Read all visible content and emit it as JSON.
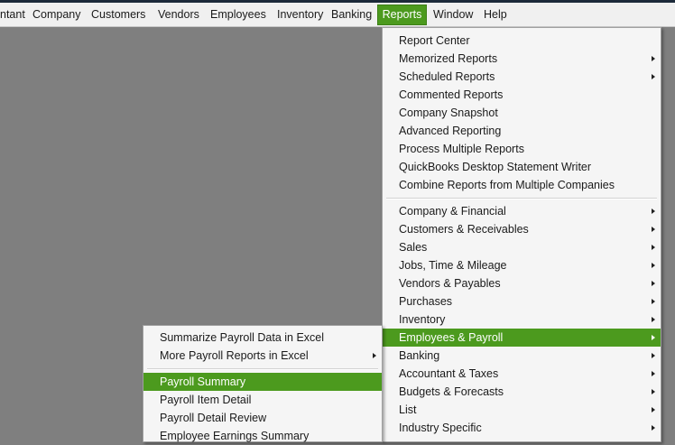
{
  "menubar": {
    "items": [
      {
        "label": "ntant"
      },
      {
        "label": "Company"
      },
      {
        "label": "Customers"
      },
      {
        "label": "Vendors"
      },
      {
        "label": "Employees"
      },
      {
        "label": "Inventory"
      },
      {
        "label": "Banking"
      },
      {
        "label": "Reports"
      },
      {
        "label": "Window"
      },
      {
        "label": "Help"
      }
    ]
  },
  "reports_menu": {
    "items": [
      {
        "label": "Report Center"
      },
      {
        "label": "Memorized Reports"
      },
      {
        "label": "Scheduled Reports"
      },
      {
        "label": "Commented Reports"
      },
      {
        "label": "Company Snapshot"
      },
      {
        "label": "Advanced Reporting"
      },
      {
        "label": "Process Multiple Reports"
      },
      {
        "label": "QuickBooks Desktop Statement Writer"
      },
      {
        "label": "Combine Reports from Multiple Companies"
      },
      {
        "label": "Company & Financial"
      },
      {
        "label": "Customers & Receivables"
      },
      {
        "label": "Sales"
      },
      {
        "label": "Jobs, Time & Mileage"
      },
      {
        "label": "Vendors & Payables"
      },
      {
        "label": "Purchases"
      },
      {
        "label": "Inventory"
      },
      {
        "label": "Employees & Payroll"
      },
      {
        "label": "Banking"
      },
      {
        "label": "Accountant & Taxes"
      },
      {
        "label": "Budgets & Forecasts"
      },
      {
        "label": "List"
      },
      {
        "label": "Industry Specific"
      }
    ]
  },
  "payroll_submenu": {
    "items": [
      {
        "label": "Summarize Payroll Data in Excel"
      },
      {
        "label": "More Payroll Reports in Excel"
      },
      {
        "label": "Payroll Summary"
      },
      {
        "label": "Payroll Item Detail"
      },
      {
        "label": "Payroll Detail Review"
      },
      {
        "label": "Employee Earnings Summary"
      }
    ]
  },
  "colors": {
    "highlight": "#4c9a1e",
    "background": "#7f7f7f",
    "menu_bg": "#f5f5f5"
  },
  "icons": {
    "submenu_arrow": "chevron-right-icon"
  }
}
